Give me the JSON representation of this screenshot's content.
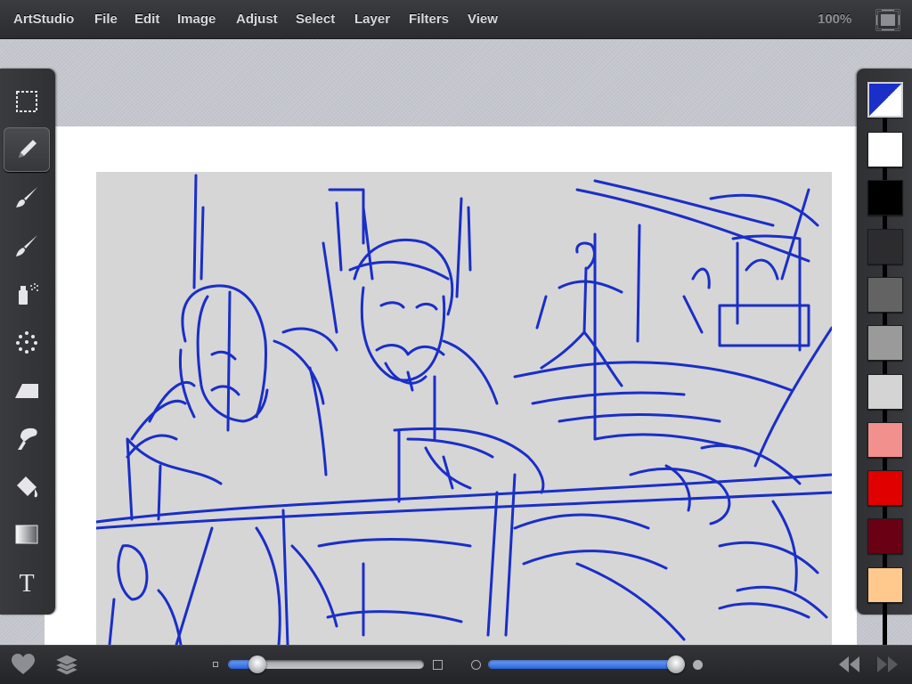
{
  "app": {
    "name": "ArtStudio",
    "menu": [
      "File",
      "Edit",
      "Image",
      "Adjust",
      "Select",
      "Layer",
      "Filters",
      "View"
    ],
    "zoom": "100%"
  },
  "tools": [
    {
      "name": "rectangle-select",
      "icon": "marquee-icon",
      "active": false
    },
    {
      "name": "pencil",
      "icon": "pencil-icon",
      "active": true
    },
    {
      "name": "brush",
      "icon": "brush-icon",
      "active": false
    },
    {
      "name": "smudge-brush",
      "icon": "brush-icon",
      "active": false
    },
    {
      "name": "spray",
      "icon": "spray-can-icon",
      "active": false
    },
    {
      "name": "scatter",
      "icon": "dots-icon",
      "active": false
    },
    {
      "name": "eraser",
      "icon": "eraser-icon",
      "active": false
    },
    {
      "name": "smudge",
      "icon": "finger-icon",
      "active": false
    },
    {
      "name": "fill",
      "icon": "paint-bucket-icon",
      "active": false
    },
    {
      "name": "gradient",
      "icon": "gradient-icon",
      "active": false
    },
    {
      "name": "text",
      "icon": "text-icon",
      "active": false
    }
  ],
  "palette": {
    "current": {
      "foreground": "#1a2ec8",
      "background": "#ffffff"
    },
    "swatches": [
      "#ffffff",
      "#000000",
      "#2c2c2e",
      "#636363",
      "#9a9a9a",
      "#d4d4d4",
      "#f2908e",
      "#e00000",
      "#6a0013",
      "#ffc98e"
    ]
  },
  "bottom": {
    "size_slider": 0.15,
    "opacity_slider": 0.96,
    "icons": [
      "heart-icon",
      "layers-icon",
      "undo-icon",
      "redo-icon"
    ]
  },
  "colors": {
    "sketch_stroke": "#1a2ec8",
    "canvas": "#d6d6d6",
    "paper": "#ffffff"
  }
}
